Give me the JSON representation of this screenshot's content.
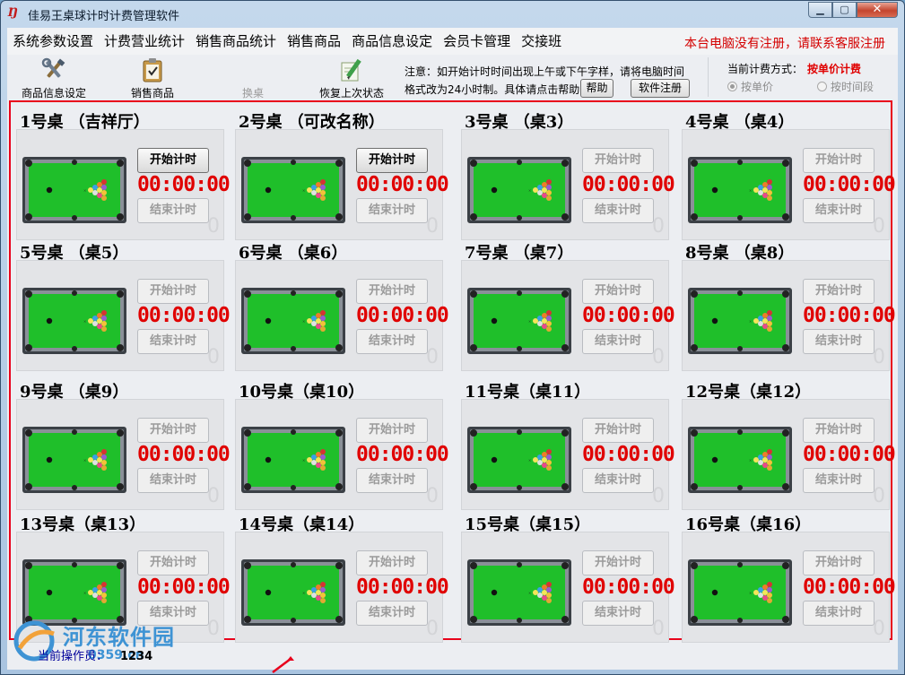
{
  "window": {
    "title": "佳易王桌球计时计费管理软件",
    "controls": {
      "minimize": "▁",
      "maximize": "▢",
      "close": "✕"
    }
  },
  "menu": {
    "items": [
      "系统参数设置",
      "计费营业统计",
      "销售商品统计",
      "销售商品",
      "商品信息设定",
      "会员卡管理",
      "交接班"
    ],
    "registration_warning": "本台电脑没有注册，请联系客服注册"
  },
  "toolbar": {
    "tools": [
      {
        "label": "商品信息设定",
        "icon": "tools-icon",
        "enabled": true
      },
      {
        "label": "销售商品",
        "icon": "clipboard-icon",
        "enabled": true
      },
      {
        "label": "换桌",
        "icon": "",
        "enabled": false
      },
      {
        "label": "恢复上次状态",
        "icon": "pencil-paper-icon",
        "enabled": true
      }
    ],
    "notice_line1": "注意：如开始计时时间出现上午或下午字样，请将电脑时间",
    "notice_line2": "格式改为24小时制。具体请点击帮助",
    "help_label": "帮助",
    "register_label": "软件注册"
  },
  "billing": {
    "label": "当前计费方式：",
    "mode": "按单价计费",
    "options": [
      {
        "label": "按单价",
        "selected": true
      },
      {
        "label": "按时间段",
        "selected": false
      }
    ]
  },
  "tables": [
    {
      "name": "1号桌 （吉祥厅）",
      "start_enabled": true
    },
    {
      "name": "2号桌 （可改名称）",
      "start_enabled": true
    },
    {
      "name": "3号桌 （桌3）",
      "start_enabled": false
    },
    {
      "name": "4号桌 （桌4）",
      "start_enabled": false
    },
    {
      "name": "5号桌 （桌5）",
      "start_enabled": false
    },
    {
      "name": "6号桌 （桌6）",
      "start_enabled": false
    },
    {
      "name": "7号桌 （桌7）",
      "start_enabled": false
    },
    {
      "name": "8号桌 （桌8）",
      "start_enabled": false
    },
    {
      "name": "9号桌 （桌9）",
      "start_enabled": false
    },
    {
      "name": "10号桌（桌10）",
      "start_enabled": false
    },
    {
      "name": "11号桌（桌11）",
      "start_enabled": false
    },
    {
      "name": "12号桌（桌12）",
      "start_enabled": false
    },
    {
      "name": "13号桌（桌13）",
      "start_enabled": false
    },
    {
      "name": "14号桌（桌14）",
      "start_enabled": false
    },
    {
      "name": "15号桌（桌15）",
      "start_enabled": false
    },
    {
      "name": "16号桌（桌16）",
      "start_enabled": false
    }
  ],
  "table_common": {
    "start_label": "开始计时",
    "end_label": "结束计时",
    "timer": "00:00:00",
    "counter": "0"
  },
  "status_bar": {
    "operator_label": "当前操作员：",
    "operator_value": "1234"
  },
  "watermark": {
    "text": "河东软件园",
    "sub": "0359.cn"
  },
  "colors": {
    "timer": "#e00000",
    "felt": "#1fbf2a",
    "highlight_frame": "#e8001c",
    "warning": "#d40000"
  }
}
